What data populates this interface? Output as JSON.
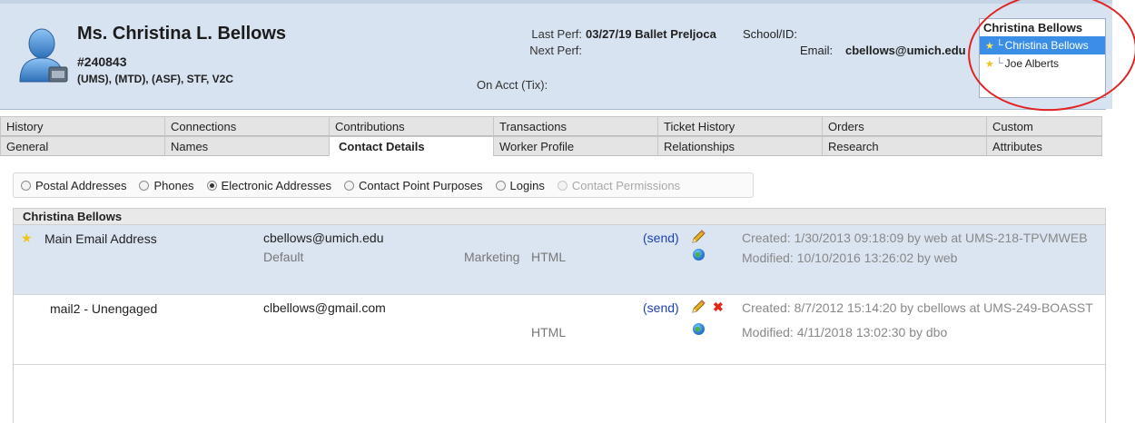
{
  "customer": {
    "name": "Ms. Christina L. Bellows",
    "id": "#240843",
    "flags": "(UMS), (MTD), (ASF), STF, V2C"
  },
  "performance": {
    "last_label": "Last Perf:",
    "last_value": "03/27/19 Ballet Preljoca",
    "next_label": "Next Perf:",
    "next_value": "",
    "acct_label": "On Acct (Tix):"
  },
  "contact": {
    "school_label": "School/ID:",
    "email_label": "Email:",
    "email_value": "cbellows@umich.edu"
  },
  "household": {
    "title": "Christina Bellows",
    "members": [
      {
        "name": "Christina Bellows",
        "selected": true
      },
      {
        "name": "Joe Alberts",
        "selected": false
      }
    ]
  },
  "tabs": {
    "row1": [
      "History",
      "Connections",
      "Contributions",
      "Transactions",
      "Ticket History",
      "Orders",
      "Custom"
    ],
    "row2": [
      "General",
      "Names",
      "Contact Details",
      "Worker Profile",
      "Relationships",
      "Research",
      "Attributes"
    ],
    "active": "Contact Details"
  },
  "radio_options": [
    {
      "label": "Postal Addresses",
      "checked": false,
      "disabled": false
    },
    {
      "label": "Phones",
      "checked": false,
      "disabled": false
    },
    {
      "label": "Electronic Addresses",
      "checked": true,
      "disabled": false
    },
    {
      "label": "Contact Point Purposes",
      "checked": false,
      "disabled": false
    },
    {
      "label": "Logins",
      "checked": false,
      "disabled": false
    },
    {
      "label": "Contact Permissions",
      "checked": false,
      "disabled": true
    }
  ],
  "grid": {
    "group_title": "Christina Bellows",
    "rows": [
      {
        "type": "Main Email Address",
        "primary": true,
        "address": "cbellows@umich.edu",
        "default_label": "Default",
        "marketing": "Marketing",
        "format": "HTML",
        "send_label": "(send)",
        "created": "Created: 1/30/2013 09:18:09 by web at UMS-218-TPVMWEB",
        "modified": "Modified: 10/10/2016 13:26:02 by web"
      },
      {
        "type": "mail2 - Unengaged",
        "primary": false,
        "address": "clbellows@gmail.com",
        "format": "HTML",
        "send_label": "(send)",
        "created": "Created: 8/7/2012 15:14:20 by cbellows at UMS-249-BOASST",
        "modified": "Modified: 4/11/2018 13:02:30 by dbo"
      }
    ]
  },
  "colors": {
    "header_bg": "#d8e3f1",
    "selected_row": "#dbe5f1",
    "household_selected": "#3a8ee6",
    "annotation_circle": "#e02424",
    "send_link": "#1c3fb5"
  },
  "icons": {
    "avatar": "person-avatar-icon",
    "primary": "star-icon",
    "edit": "pencil-icon",
    "delete": "delete-x-icon",
    "web": "globe-icon"
  }
}
